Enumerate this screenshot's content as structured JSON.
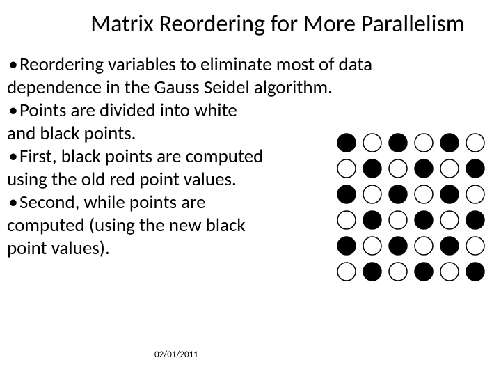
{
  "title": "Matrix Reordering for More Parallelism",
  "bullet_glyph": "•",
  "lines": {
    "l1a": "Reordering variables to eliminate most of data",
    "l1b": "dependence in the Gauss Seidel algorithm.",
    "l2a": "Points are divided into white",
    "l2b": "and black points.",
    "l3a": "First, black points are computed",
    "l3b": " using the old red point values.",
    "l4a": "Second, while points are",
    "l4b": "computed (using the new black",
    "l4c": " point values)."
  },
  "footer_date": "02/01/2011",
  "grid": {
    "rows": 6,
    "cols": 6,
    "radius": 13,
    "spacing": 37,
    "start_black": true,
    "stroke": "#000",
    "fill_black": "#000",
    "fill_white": "#fff"
  }
}
